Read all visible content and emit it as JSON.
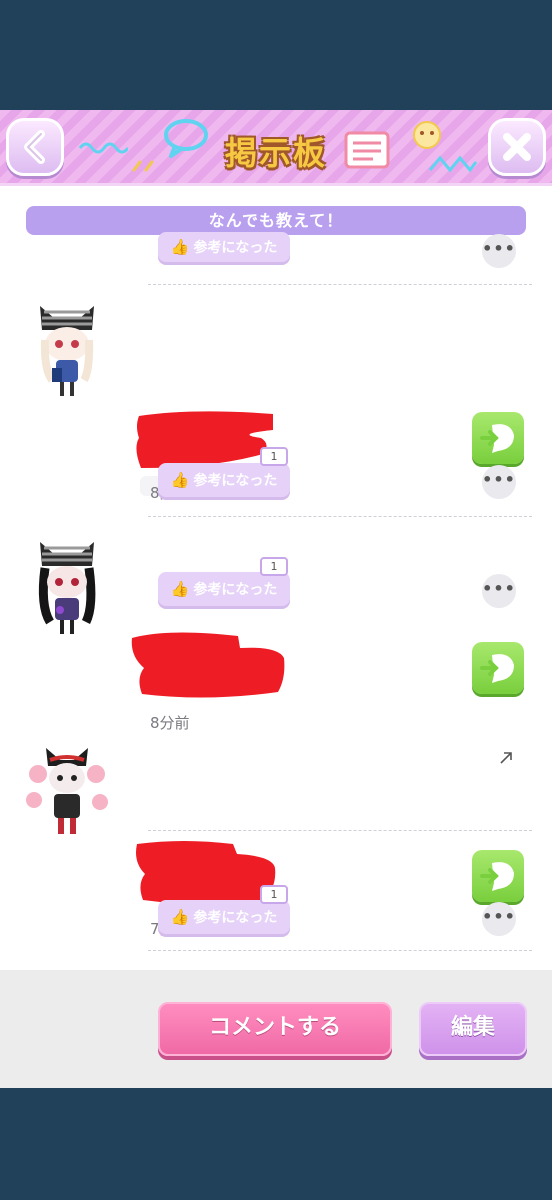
{
  "header": {
    "title": "掲示板",
    "back_icon": "chevron-left-icon",
    "close_icon": "close-icon"
  },
  "topic": {
    "title": "なんでも教えて！"
  },
  "helpful_label": "参考になった",
  "posts": [
    {
      "time": "8分前",
      "helpful_count": "1"
    },
    {
      "time": "8分前",
      "helpful_count": "1"
    },
    {
      "time": "7分前"
    }
  ],
  "footer": {
    "comment_label": "コメントする",
    "edit_label": "編集"
  },
  "colors": {
    "header_pink": "#e7a6ea",
    "topic_purple": "#b9a0ef",
    "reply_green": "#79cf3d",
    "comment_pink": "#f06aa6",
    "edit_purple": "#cf92ea",
    "redaction_red": "#ee1c24"
  }
}
